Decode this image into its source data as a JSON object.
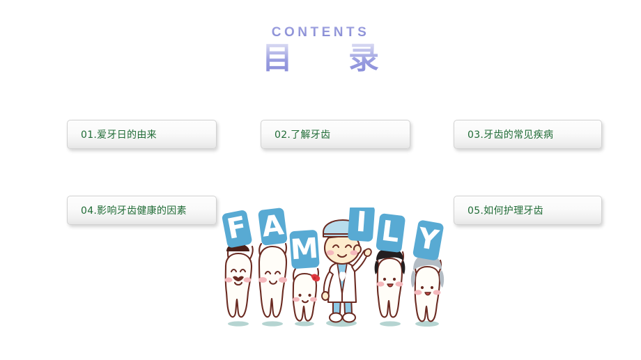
{
  "slide": {
    "background_color": "#ffffff",
    "title": {
      "english": "CONTENTS",
      "chinese": "目　录",
      "accent_color": "#8387d6"
    },
    "menu_items": [
      {
        "id": "01",
        "label": "01.爱牙日的由来",
        "text_color": "#1f6b35"
      },
      {
        "id": "02",
        "label": "02.了解牙齿",
        "text_color": "#1f6b35"
      },
      {
        "id": "03",
        "label": "03.牙齿的常见疾病",
        "text_color": "#1f6b35"
      },
      {
        "id": "04",
        "label": "04.影响牙齿健康的因素",
        "text_color": "#1f6b35"
      },
      {
        "id": "05",
        "label": "05.如何护理牙齿",
        "text_color": "#1f6b35"
      }
    ],
    "illustration": {
      "name": "family-teeth-cartoon",
      "word": "FAMILY",
      "letters": [
        "F",
        "A",
        "M",
        "I",
        "L",
        "Y"
      ],
      "card_color": "#58aad3",
      "letter_color": "#ffffff",
      "tooth_outline_color": "#6b2b22",
      "tooth_fill_color": "#fffdf8",
      "cheek_color": "#f4b8bc",
      "shadow_color": "#9cc5c2",
      "characters": [
        {
          "name": "grandfather-tooth",
          "accessory": "brown-hat",
          "hair_color": "#4a1f18"
        },
        {
          "name": "father-tooth",
          "accessory": "none",
          "hair_color": "#6b2b22"
        },
        {
          "name": "child-tooth",
          "accessory": "red-bow",
          "hair_color": "#e0383f"
        },
        {
          "name": "dentist-boy",
          "accessory": "blue-surgical-cap",
          "coat_color": "#ffffff",
          "scrubs_color": "#8ecae6",
          "hair_color": "#5c2a1e"
        },
        {
          "name": "mother-tooth",
          "accessory": "black-bob-hair",
          "hair_color": "#231f20"
        },
        {
          "name": "grandmother-tooth",
          "accessory": "gray-hair",
          "hair_color": "#b3bcc4"
        }
      ]
    }
  }
}
